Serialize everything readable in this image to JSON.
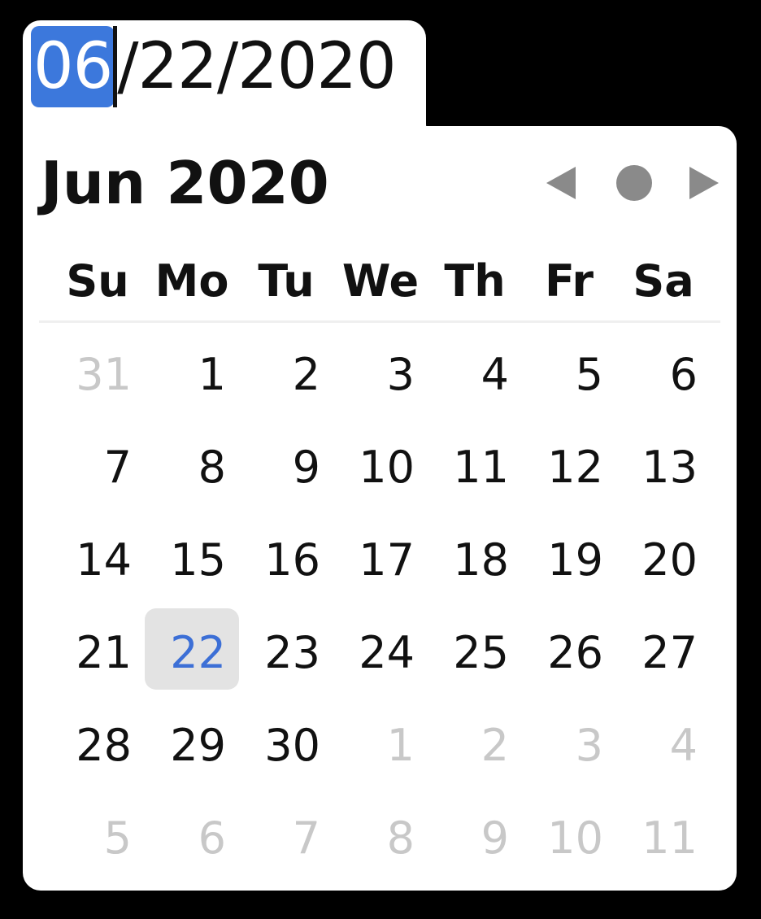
{
  "date_input": {
    "month": "06",
    "sep1": "/",
    "day": "22",
    "sep2": "/",
    "year": "2020"
  },
  "calendar": {
    "title": "Jun 2020",
    "weekdays": [
      "Su",
      "Mo",
      "Tu",
      "We",
      "Th",
      "Fr",
      "Sa"
    ],
    "nav": {
      "prev_icon": "triangle-left-icon",
      "today_icon": "circle-icon",
      "next_icon": "triangle-right-icon"
    },
    "weeks": [
      [
        "31",
        "1",
        "2",
        "3",
        "4",
        "5",
        "6"
      ],
      [
        "7",
        "8",
        "9",
        "10",
        "11",
        "12",
        "13"
      ],
      [
        "14",
        "15",
        "16",
        "17",
        "18",
        "19",
        "20"
      ],
      [
        "21",
        "22",
        "23",
        "24",
        "25",
        "26",
        "27"
      ],
      [
        "28",
        "29",
        "30",
        "1",
        "2",
        "3",
        "4"
      ],
      [
        "5",
        "6",
        "7",
        "8",
        "9",
        "10",
        "11"
      ]
    ],
    "selected_day": "22",
    "colors": {
      "accent": "#3c78dc",
      "selected_text": "#3c6fd6",
      "muted": "#c8c8c8",
      "nav": "#8a8a8a"
    }
  }
}
